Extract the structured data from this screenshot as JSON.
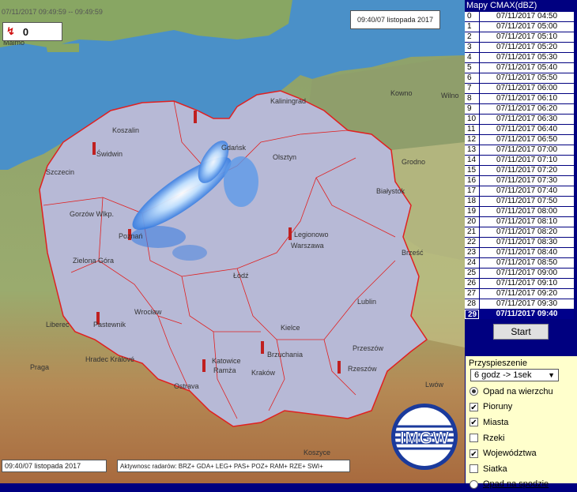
{
  "map": {
    "timestamp_top": "07/11/2017 09:49:59 -- 09:49:59",
    "timestamp_right": "09:40/07 listopada 2017",
    "timestamp_bottom": "09:40/07 listopada 2017",
    "activity": "Aktywnosc radarów: BRZ+ GDA+ LEG+ PAS+ POZ+ RAM+ RZE+ SWI+",
    "lightning_count": "0",
    "cities": [
      {
        "name": "Malmo"
      },
      {
        "name": "Koszalin"
      },
      {
        "name": "Świdwin"
      },
      {
        "name": "Szczecin"
      },
      {
        "name": "Gorzów Wlkp."
      },
      {
        "name": "Zielona Góra"
      },
      {
        "name": "Wrocław"
      },
      {
        "name": "Pastewnik"
      },
      {
        "name": "Liberec"
      },
      {
        "name": "Hradec Králové"
      },
      {
        "name": "Praga"
      },
      {
        "name": "Ostrava"
      },
      {
        "name": "Katowice"
      },
      {
        "name": "Ramża"
      },
      {
        "name": "Kraków"
      },
      {
        "name": "Brzuchania"
      },
      {
        "name": "Kielce"
      },
      {
        "name": "Łódź"
      },
      {
        "name": "Legionowo"
      },
      {
        "name": "Warszawa"
      },
      {
        "name": "Lublin"
      },
      {
        "name": "Rzeszów"
      },
      {
        "name": "Przeszów"
      },
      {
        "name": "Lwów"
      },
      {
        "name": "Olsztyn"
      },
      {
        "name": "Kaliningrad"
      },
      {
        "name": "Kowno"
      },
      {
        "name": "Wilno"
      },
      {
        "name": "Grodno"
      },
      {
        "name": "Białystok"
      },
      {
        "name": "Brześć"
      },
      {
        "name": "Koszyce"
      },
      {
        "name": "Gdańsk"
      },
      {
        "name": "Poznań"
      }
    ],
    "logo_text": "IMGW"
  },
  "panel": {
    "title": "Mapy CMAX(dBZ)",
    "times": [
      {
        "idx": "0",
        "t": "07/11/2017 04:50"
      },
      {
        "idx": "1",
        "t": "07/11/2017 05:00"
      },
      {
        "idx": "2",
        "t": "07/11/2017 05:10"
      },
      {
        "idx": "3",
        "t": "07/11/2017 05:20"
      },
      {
        "idx": "4",
        "t": "07/11/2017 05:30"
      },
      {
        "idx": "5",
        "t": "07/11/2017 05:40"
      },
      {
        "idx": "6",
        "t": "07/11/2017 05:50"
      },
      {
        "idx": "7",
        "t": "07/11/2017 06:00"
      },
      {
        "idx": "8",
        "t": "07/11/2017 06:10"
      },
      {
        "idx": "9",
        "t": "07/11/2017 06:20"
      },
      {
        "idx": "10",
        "t": "07/11/2017 06:30"
      },
      {
        "idx": "11",
        "t": "07/11/2017 06:40"
      },
      {
        "idx": "12",
        "t": "07/11/2017 06:50"
      },
      {
        "idx": "13",
        "t": "07/11/2017 07:00"
      },
      {
        "idx": "14",
        "t": "07/11/2017 07:10"
      },
      {
        "idx": "15",
        "t": "07/11/2017 07:20"
      },
      {
        "idx": "16",
        "t": "07/11/2017 07:30"
      },
      {
        "idx": "17",
        "t": "07/11/2017 07:40"
      },
      {
        "idx": "18",
        "t": "07/11/2017 07:50"
      },
      {
        "idx": "19",
        "t": "07/11/2017 08:00"
      },
      {
        "idx": "20",
        "t": "07/11/2017 08:10"
      },
      {
        "idx": "21",
        "t": "07/11/2017 08:20"
      },
      {
        "idx": "22",
        "t": "07/11/2017 08:30"
      },
      {
        "idx": "23",
        "t": "07/11/2017 08:40"
      },
      {
        "idx": "24",
        "t": "07/11/2017 08:50"
      },
      {
        "idx": "25",
        "t": "07/11/2017 09:00"
      },
      {
        "idx": "26",
        "t": "07/11/2017 09:10"
      },
      {
        "idx": "27",
        "t": "07/11/2017 09:20"
      },
      {
        "idx": "28",
        "t": "07/11/2017 09:30"
      },
      {
        "idx": "29",
        "t": "07/11/2017 09:40"
      }
    ],
    "active_index": 29,
    "start_label": "Start",
    "speed_label": "Przyspieszenie",
    "speed_value": "6 godz -> 1sek",
    "options": [
      {
        "type": "radio",
        "label": "Opad na wierzchu",
        "checked": true,
        "underline": false
      },
      {
        "type": "checkbox",
        "label": "Pioruny",
        "checked": true,
        "underline": false
      },
      {
        "type": "checkbox",
        "label": "Miasta",
        "checked": true,
        "underline": false
      },
      {
        "type": "checkbox",
        "label": "Rzeki",
        "checked": false,
        "underline": false
      },
      {
        "type": "checkbox",
        "label": "Województwa",
        "checked": true,
        "underline": false
      },
      {
        "type": "checkbox",
        "label": "Siatka",
        "checked": false,
        "underline": false
      },
      {
        "type": "radio",
        "label": "Opad na spodzie",
        "checked": false,
        "underline": true
      }
    ]
  },
  "colors": {
    "panel_bg": "#000080",
    "active_row": "#00008b",
    "options_bg": "#ffffcc",
    "sea": "#4a90c8",
    "country": "#b7b9d6",
    "border": "#e02020"
  }
}
